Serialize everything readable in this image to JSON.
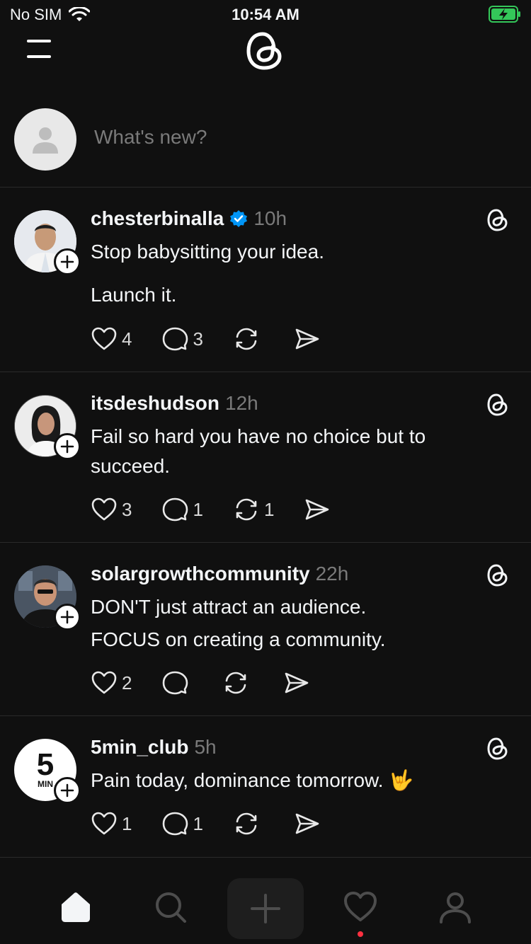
{
  "status_bar": {
    "carrier": "No SIM",
    "time": "10:54 AM"
  },
  "composer": {
    "placeholder": "What's new?"
  },
  "posts": [
    {
      "username": "chesterbinalla",
      "verified": true,
      "time": "10h",
      "lines": [
        "Stop babysitting your idea.",
        "Launch it."
      ],
      "likes": "4",
      "replies": "3",
      "reposts": ""
    },
    {
      "username": "itsdeshudson",
      "verified": false,
      "time": "12h",
      "lines": [
        "Fail so hard you have no choice but to succeed."
      ],
      "likes": "3",
      "replies": "1",
      "reposts": "1"
    },
    {
      "username": "solargrowthcommunity",
      "verified": false,
      "time": "22h",
      "lines": [
        "DON'T just attract an audience.",
        "FOCUS on creating a community."
      ],
      "likes": "2",
      "replies": "",
      "reposts": ""
    },
    {
      "username": "5min_club",
      "verified": false,
      "time": "5h",
      "lines": [
        "Pain today, dominance tomorrow. 🤟"
      ],
      "avatar_text": "5",
      "avatar_subtext": "MIN",
      "likes": "1",
      "replies": "1",
      "reposts": ""
    }
  ],
  "colors": {
    "background": "#101010",
    "verified": "#0095f6",
    "notification": "#ff3040"
  }
}
